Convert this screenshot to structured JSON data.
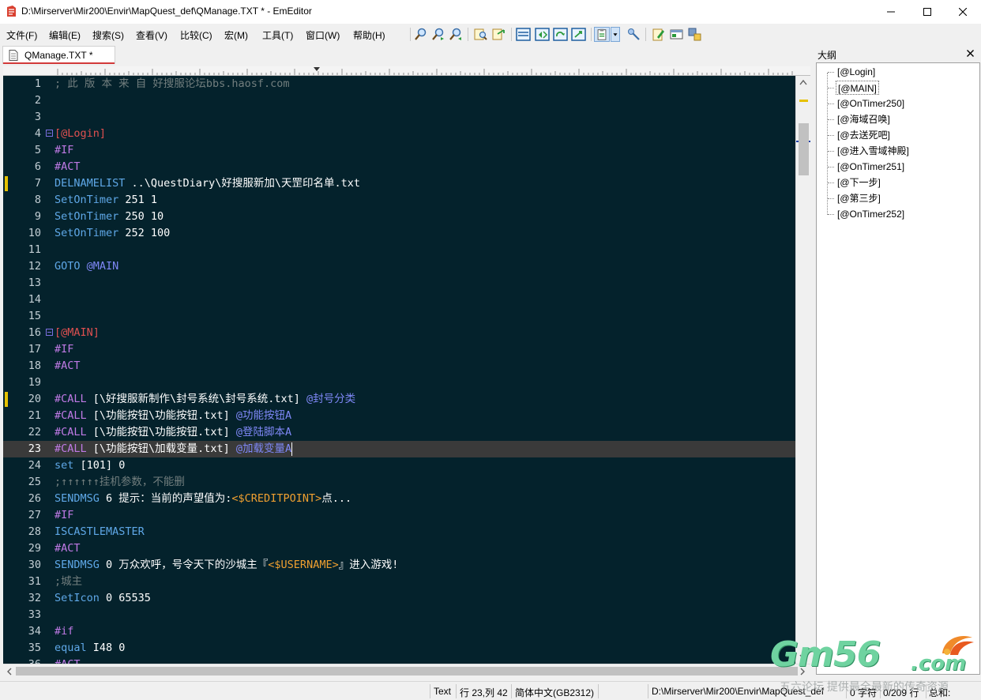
{
  "window": {
    "title": "D:\\Mirserver\\Mir200\\Envir\\MapQuest_def\\QManage.TXT * - EmEditor",
    "icons": [
      "app-icon",
      "minimize-icon",
      "maximize-icon",
      "close-icon"
    ]
  },
  "menu": [
    {
      "label": "文件(F)"
    },
    {
      "label": "编辑(E)"
    },
    {
      "label": "搜索(S)"
    },
    {
      "label": "查看(V)"
    },
    {
      "label": "比较(C)"
    },
    {
      "label": "宏(M)"
    },
    {
      "label": "工具(T)"
    },
    {
      "label": "窗口(W)"
    },
    {
      "label": "帮助(H)"
    }
  ],
  "toolbar": [
    {
      "icon": "find-icon"
    },
    {
      "icon": "find-next-icon"
    },
    {
      "icon": "find-prev-icon"
    },
    {
      "icon": "find-in-files-icon"
    },
    {
      "icon": "replace-in-files-icon"
    },
    {
      "icon": "view-split-icon"
    },
    {
      "icon": "view-wrap-icon"
    },
    {
      "icon": "view-refresh-icon"
    },
    {
      "icon": "view-sync-icon"
    },
    {
      "icon": "clipboard-icon"
    },
    {
      "icon": "dropdown-icon"
    },
    {
      "icon": "tools-icon"
    },
    {
      "icon": "edit-icon"
    },
    {
      "icon": "window-icon"
    },
    {
      "icon": "plugin-icon"
    }
  ],
  "tab": {
    "label": "QManage.TXT *",
    "icon": "document-icon"
  },
  "editor": {
    "current_line": 23,
    "change_marks": [
      7,
      20
    ],
    "fold_lines": [
      4,
      16
    ],
    "lines": [
      {
        "n": "1",
        "tokens": [
          {
            "t": "; 此 版 本 来 自 好搜服论坛bbs.haosf.com",
            "c": "comment"
          }
        ]
      },
      {
        "n": "2",
        "tokens": []
      },
      {
        "n": "3",
        "tokens": []
      },
      {
        "n": "4",
        "tokens": [
          {
            "t": "[@Login]",
            "c": "label"
          }
        ]
      },
      {
        "n": "5",
        "tokens": [
          {
            "t": "#IF",
            "c": "keyword"
          }
        ]
      },
      {
        "n": "6",
        "tokens": [
          {
            "t": "#ACT",
            "c": "keyword"
          }
        ]
      },
      {
        "n": "7",
        "tokens": [
          {
            "t": "DELNAMELIST",
            "c": "func"
          },
          {
            "t": " ..\\QuestDiary\\好搜服新加\\天罡印名单.txt",
            "c": "text"
          }
        ]
      },
      {
        "n": "8",
        "tokens": [
          {
            "t": "SetOnTimer",
            "c": "func"
          },
          {
            "t": " 251 1",
            "c": "number"
          }
        ]
      },
      {
        "n": "9",
        "tokens": [
          {
            "t": "SetOnTimer",
            "c": "func"
          },
          {
            "t": " 250 10",
            "c": "number"
          }
        ]
      },
      {
        "n": "10",
        "tokens": [
          {
            "t": "SetOnTimer",
            "c": "func"
          },
          {
            "t": " 252 100",
            "c": "number"
          }
        ]
      },
      {
        "n": "11",
        "tokens": []
      },
      {
        "n": "12",
        "tokens": [
          {
            "t": "GOTO",
            "c": "func"
          },
          {
            "t": " @MAIN",
            "c": "tag"
          }
        ]
      },
      {
        "n": "13",
        "tokens": []
      },
      {
        "n": "14",
        "tokens": []
      },
      {
        "n": "15",
        "tokens": []
      },
      {
        "n": "16",
        "tokens": [
          {
            "t": "[@MAIN]",
            "c": "label"
          }
        ]
      },
      {
        "n": "17",
        "tokens": [
          {
            "t": "#IF",
            "c": "keyword"
          }
        ]
      },
      {
        "n": "18",
        "tokens": [
          {
            "t": "#ACT",
            "c": "keyword"
          }
        ]
      },
      {
        "n": "19",
        "tokens": []
      },
      {
        "n": "20",
        "tokens": [
          {
            "t": "#CALL",
            "c": "keyword"
          },
          {
            "t": " [\\好搜服新制作\\封号系统\\封号系统.txt] ",
            "c": "text"
          },
          {
            "t": "@封号分类",
            "c": "tag"
          }
        ]
      },
      {
        "n": "21",
        "tokens": [
          {
            "t": "#CALL",
            "c": "keyword"
          },
          {
            "t": " [\\功能按钮\\功能按钮.txt] ",
            "c": "text"
          },
          {
            "t": "@功能按钮A",
            "c": "tag"
          }
        ]
      },
      {
        "n": "22",
        "tokens": [
          {
            "t": "#CALL",
            "c": "keyword"
          },
          {
            "t": " [\\功能按钮\\功能按钮.txt] ",
            "c": "text"
          },
          {
            "t": "@登陆脚本A",
            "c": "tag"
          }
        ]
      },
      {
        "n": "23",
        "tokens": [
          {
            "t": "#CALL",
            "c": "keyword"
          },
          {
            "t": " [\\功能按钮\\加载变量.txt] ",
            "c": "text"
          },
          {
            "t": "@加载变量A",
            "c": "tag"
          }
        ]
      },
      {
        "n": "24",
        "tokens": [
          {
            "t": "set",
            "c": "func"
          },
          {
            "t": " [101] 0",
            "c": "number"
          }
        ]
      },
      {
        "n": "25",
        "tokens": [
          {
            "t": ";↑↑↑↑↑↑挂机参数，不能删",
            "c": "comment"
          }
        ]
      },
      {
        "n": "26",
        "tokens": [
          {
            "t": "SENDMSG",
            "c": "func"
          },
          {
            "t": " 6 提示：当前的声望值为:",
            "c": "text"
          },
          {
            "t": "<$CREDITPOINT>",
            "c": "var"
          },
          {
            "t": "点...",
            "c": "text"
          }
        ]
      },
      {
        "n": "27",
        "tokens": [
          {
            "t": "#IF",
            "c": "keyword"
          }
        ]
      },
      {
        "n": "28",
        "tokens": [
          {
            "t": "ISCASTLEMASTER",
            "c": "func"
          }
        ]
      },
      {
        "n": "29",
        "tokens": [
          {
            "t": "#ACT",
            "c": "keyword"
          }
        ]
      },
      {
        "n": "30",
        "tokens": [
          {
            "t": "SENDMSG",
            "c": "func"
          },
          {
            "t": " 0 万众欢呼，号令天下的沙城主『",
            "c": "text"
          },
          {
            "t": "<$USERNAME>",
            "c": "var"
          },
          {
            "t": "』进入游戏!",
            "c": "text"
          }
        ]
      },
      {
        "n": "31",
        "tokens": [
          {
            "t": ";城主",
            "c": "comment"
          }
        ]
      },
      {
        "n": "32",
        "tokens": [
          {
            "t": "SetIcon",
            "c": "func"
          },
          {
            "t": " 0 65535",
            "c": "number"
          }
        ]
      },
      {
        "n": "33",
        "tokens": []
      },
      {
        "n": "34",
        "tokens": [
          {
            "t": "#if",
            "c": "keyword"
          }
        ]
      },
      {
        "n": "35",
        "tokens": [
          {
            "t": "equal",
            "c": "func"
          },
          {
            "t": " I48 0",
            "c": "number"
          }
        ]
      },
      {
        "n": "36",
        "tokens": [
          {
            "t": "#ACT",
            "c": "keyword"
          }
        ]
      }
    ]
  },
  "outline": {
    "title": "大纲",
    "selected_index": 1,
    "items": [
      {
        "label": "[@Login]"
      },
      {
        "label": "[@MAIN]"
      },
      {
        "label": "[@OnTimer250]"
      },
      {
        "label": "[@海域召唤]"
      },
      {
        "label": "[@去送死吧]"
      },
      {
        "label": "[@进入雪域神殿]"
      },
      {
        "label": "[@OnTimer251]"
      },
      {
        "label": "[@下一步]"
      },
      {
        "label": "[@第三步]"
      },
      {
        "label": "[@OnTimer252]"
      }
    ]
  },
  "status": {
    "mode": "Text",
    "position": "行 23,列 42",
    "encoding": "简体中文(GB2312)",
    "path": "D:\\Mirserver\\Mir200\\Envir\\MapQuest_def",
    "chars": "0 字符",
    "lines": "0/209 行",
    "total": "总和:"
  },
  "watermark": {
    "logo": "Gm56",
    "suffix": ".com",
    "tagline": "五六论坛 提供最全最新的传奇资源"
  },
  "colors": {
    "editor_bg": "#04222c",
    "comment": "#727e7e",
    "label": "#e05050",
    "keyword": "#c07ae6",
    "func": "#5fa8e8",
    "var": "#f0a030",
    "tag": "#7f88f7",
    "change_mark": "#e6c100"
  }
}
